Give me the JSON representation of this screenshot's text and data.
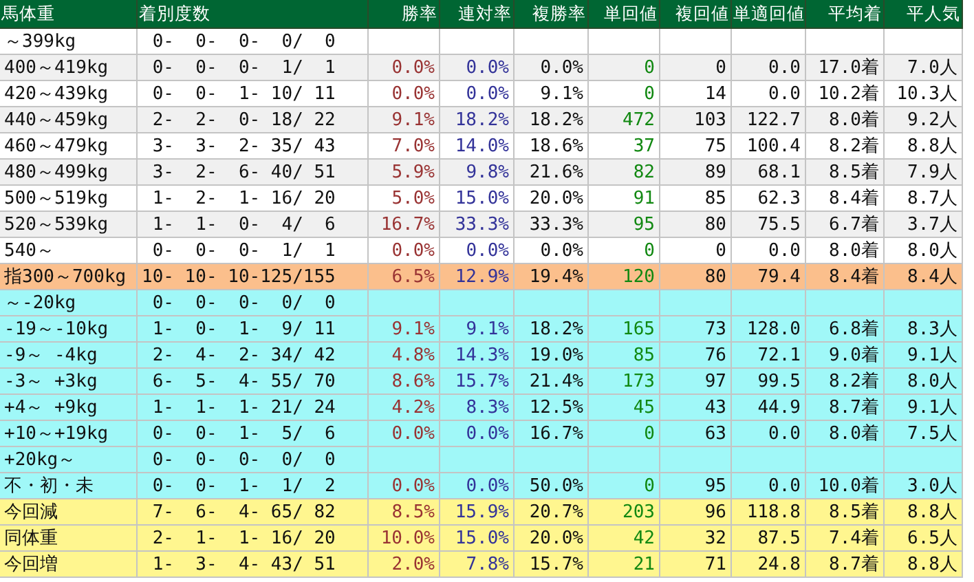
{
  "table": {
    "columns": [
      "馬体重",
      "着別度数",
      "勝率",
      "連対率",
      "複勝率",
      "単回値",
      "複回値",
      "単適回値",
      "平均着",
      "平人気"
    ],
    "rows": [
      {
        "label": "～399kg",
        "record": " 0-  0-  0-  0/  0",
        "color": "#ffffff"
      },
      {
        "label": "400～419kg",
        "record": " 0-  0-  0-  1/  1",
        "win_rate": "0.0%",
        "place_rate": "0.0%",
        "show_rate": "0.0%",
        "win_return": "0",
        "show_return": "0",
        "adj_return": "0.0",
        "avg_finish": "17.0着",
        "avg_pop": "7.0人",
        "color": "#f0f0f0"
      },
      {
        "label": "420～439kg",
        "record": " 0-  0-  1- 10/ 11",
        "win_rate": "0.0%",
        "place_rate": "0.0%",
        "show_rate": "9.1%",
        "win_return": "0",
        "show_return": "14",
        "adj_return": "0.0",
        "avg_finish": "10.2着",
        "avg_pop": "10.3人",
        "color": "#ffffff"
      },
      {
        "label": "440～459kg",
        "record": " 2-  2-  0- 18/ 22",
        "win_rate": "9.1%",
        "place_rate": "18.2%",
        "show_rate": "18.2%",
        "win_return": "472",
        "show_return": "103",
        "adj_return": "122.7",
        "avg_finish": "8.0着",
        "avg_pop": "9.2人",
        "color": "#f0f0f0"
      },
      {
        "label": "460～479kg",
        "record": " 3-  3-  2- 35/ 43",
        "win_rate": "7.0%",
        "place_rate": "14.0%",
        "show_rate": "18.6%",
        "win_return": "37",
        "show_return": "75",
        "adj_return": "100.4",
        "avg_finish": "8.2着",
        "avg_pop": "8.8人",
        "color": "#ffffff"
      },
      {
        "label": "480～499kg",
        "record": " 3-  2-  6- 40/ 51",
        "win_rate": "5.9%",
        "place_rate": "9.8%",
        "show_rate": "21.6%",
        "win_return": "82",
        "show_return": "89",
        "adj_return": "68.1",
        "avg_finish": "8.5着",
        "avg_pop": "7.9人",
        "color": "#f0f0f0"
      },
      {
        "label": "500～519kg",
        "record": " 1-  2-  1- 16/ 20",
        "win_rate": "5.0%",
        "place_rate": "15.0%",
        "show_rate": "20.0%",
        "win_return": "91",
        "show_return": "85",
        "adj_return": "62.3",
        "avg_finish": "8.4着",
        "avg_pop": "8.7人",
        "color": "#ffffff"
      },
      {
        "label": "520～539kg",
        "record": " 1-  1-  0-  4/  6",
        "win_rate": "16.7%",
        "place_rate": "33.3%",
        "show_rate": "33.3%",
        "win_return": "95",
        "show_return": "80",
        "adj_return": "75.5",
        "avg_finish": "6.7着",
        "avg_pop": "3.7人",
        "color": "#f0f0f0"
      },
      {
        "label": "540～",
        "record": " 0-  0-  0-  1/  1",
        "win_rate": "0.0%",
        "place_rate": "0.0%",
        "show_rate": "0.0%",
        "win_return": "0",
        "show_return": "0",
        "adj_return": "0.0",
        "avg_finish": "8.0着",
        "avg_pop": "8.0人",
        "color": "#ffffff"
      },
      {
        "label": "指300～700kg",
        "record": "10- 10- 10-125/155",
        "win_rate": "6.5%",
        "place_rate": "12.9%",
        "show_rate": "19.4%",
        "win_return": "120",
        "show_return": "80",
        "adj_return": "79.4",
        "avg_finish": "8.4着",
        "avg_pop": "8.4人",
        "color": "#fbbf8c"
      },
      {
        "label": "～-20kg",
        "record": " 0-  0-  0-  0/  0",
        "color": "#a0f8f8"
      },
      {
        "label": "-19～-10kg",
        "record": " 1-  0-  1-  9/ 11",
        "win_rate": "9.1%",
        "place_rate": "9.1%",
        "show_rate": "18.2%",
        "win_return": "165",
        "show_return": "73",
        "adj_return": "128.0",
        "avg_finish": "6.8着",
        "avg_pop": "8.3人",
        "color": "#a0f8f8"
      },
      {
        "label": "-9～ -4kg",
        "record": " 2-  4-  2- 34/ 42",
        "win_rate": "4.8%",
        "place_rate": "14.3%",
        "show_rate": "19.0%",
        "win_return": "85",
        "show_return": "76",
        "adj_return": "72.1",
        "avg_finish": "9.0着",
        "avg_pop": "9.1人",
        "color": "#a0f8f8"
      },
      {
        "label": "-3～ +3kg",
        "record": " 6-  5-  4- 55/ 70",
        "win_rate": "8.6%",
        "place_rate": "15.7%",
        "show_rate": "21.4%",
        "win_return": "173",
        "show_return": "97",
        "adj_return": "99.5",
        "avg_finish": "8.2着",
        "avg_pop": "8.0人",
        "color": "#a0f8f8"
      },
      {
        "label": "+4～ +9kg",
        "record": " 1-  1-  1- 21/ 24",
        "win_rate": "4.2%",
        "place_rate": "8.3%",
        "show_rate": "12.5%",
        "win_return": "45",
        "show_return": "43",
        "adj_return": "44.9",
        "avg_finish": "8.7着",
        "avg_pop": "9.1人",
        "color": "#a0f8f8"
      },
      {
        "label": "+10～+19kg",
        "record": " 0-  0-  1-  5/  6",
        "win_rate": "0.0%",
        "place_rate": "0.0%",
        "show_rate": "16.7%",
        "win_return": "0",
        "show_return": "63",
        "adj_return": "0.0",
        "avg_finish": "8.0着",
        "avg_pop": "7.5人",
        "color": "#a0f8f8"
      },
      {
        "label": "+20kg～",
        "record": " 0-  0-  0-  0/  0",
        "color": "#a0f8f8"
      },
      {
        "label": "不・初・未",
        "record": " 0-  0-  1-  1/  2",
        "win_rate": "0.0%",
        "place_rate": "0.0%",
        "show_rate": "50.0%",
        "win_return": "0",
        "show_return": "95",
        "adj_return": "0.0",
        "avg_finish": "10.0着",
        "avg_pop": "3.0人",
        "color": "#a0f8f8"
      },
      {
        "label": "今回減",
        "record": " 7-  6-  4- 65/ 82",
        "win_rate": "8.5%",
        "place_rate": "15.9%",
        "show_rate": "20.7%",
        "win_return": "203",
        "show_return": "96",
        "adj_return": "118.8",
        "avg_finish": "8.5着",
        "avg_pop": "8.8人",
        "color": "#fff68f"
      },
      {
        "label": "同体重",
        "record": " 2-  1-  1- 16/ 20",
        "win_rate": "10.0%",
        "place_rate": "15.0%",
        "show_rate": "20.0%",
        "win_return": "42",
        "show_return": "32",
        "adj_return": "87.5",
        "avg_finish": "7.4着",
        "avg_pop": "6.5人",
        "color": "#fff68f"
      },
      {
        "label": "今回増",
        "record": " 1-  3-  4- 43/ 51",
        "win_rate": "2.0%",
        "place_rate": "7.8%",
        "show_rate": "15.7%",
        "win_return": "21",
        "show_return": "71",
        "adj_return": "24.8",
        "avg_finish": "8.7着",
        "avg_pop": "8.8人",
        "color": "#fff68f"
      }
    ]
  }
}
